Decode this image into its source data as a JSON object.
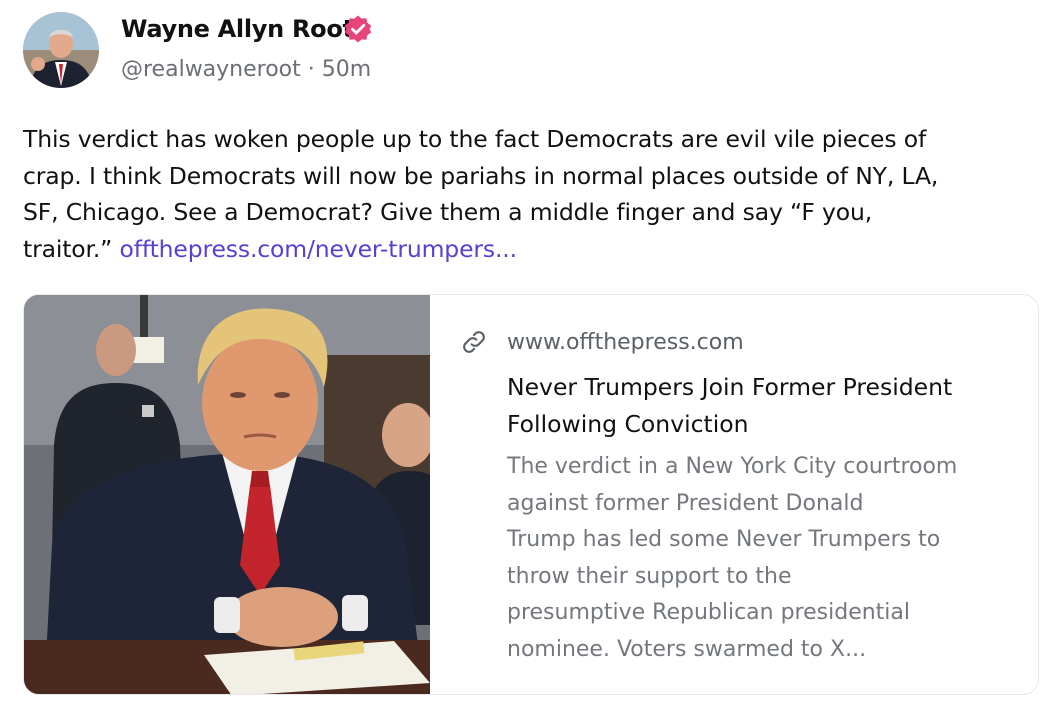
{
  "author": {
    "name": "Wayne Allyn Root",
    "handle": "@realwayneroot",
    "separator": "·",
    "timestamp": "50m",
    "verified_icon": "verified-badge-icon",
    "avatar_icon": "profile-photo"
  },
  "post": {
    "text_lines": [
      "This verdict has woken people up to the fact Democrats are evil vile pieces of",
      "crap. I think Democrats will now be pariahs in normal places outside of NY, LA,",
      "SF, Chicago. See a Democrat? Give them a middle finger and say “F you,",
      "traitor.”"
    ],
    "link_text": "offthepress.com/never-trumpers..."
  },
  "card": {
    "domain": "www.offthepress.com",
    "link_icon": "link-icon",
    "title_lines": [
      "Never Trumpers Join Former President",
      "Following Conviction"
    ],
    "description_lines": [
      "The verdict in a New York City courtroom",
      "against former President Donald",
      "Trump has led some Never Trumpers to",
      "throw their support to the",
      "presumptive Republican presidential",
      "nominee. Voters swarmed to X..."
    ]
  },
  "colors": {
    "link": "#5a3fd0",
    "verified_badge": "#e6457a",
    "muted_text": "#6b6f75",
    "card_border": "#e6e8ea"
  }
}
